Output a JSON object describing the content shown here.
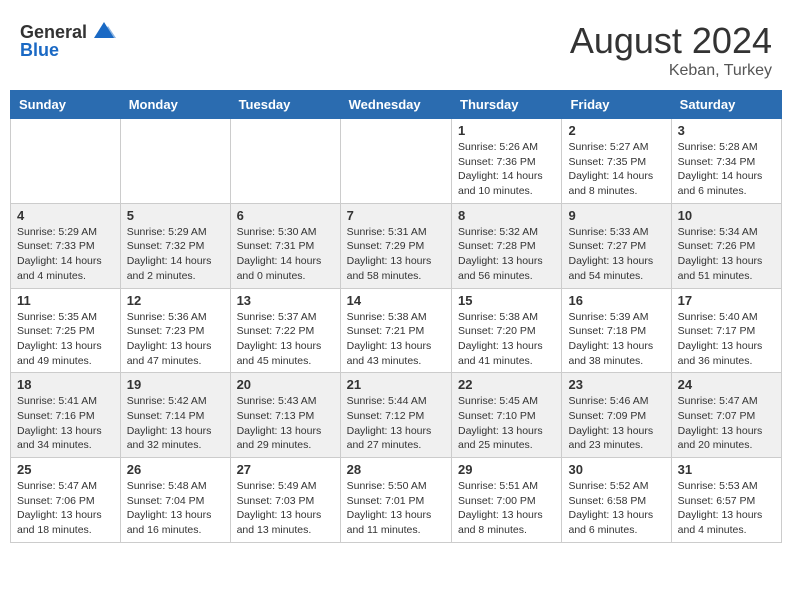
{
  "header": {
    "logo_general": "General",
    "logo_blue": "Blue",
    "month_year": "August 2024",
    "location": "Keban, Turkey"
  },
  "days_of_week": [
    "Sunday",
    "Monday",
    "Tuesday",
    "Wednesday",
    "Thursday",
    "Friday",
    "Saturday"
  ],
  "weeks": [
    [
      {
        "day": "",
        "sunrise": "",
        "sunset": "",
        "daylight": ""
      },
      {
        "day": "",
        "sunrise": "",
        "sunset": "",
        "daylight": ""
      },
      {
        "day": "",
        "sunrise": "",
        "sunset": "",
        "daylight": ""
      },
      {
        "day": "",
        "sunrise": "",
        "sunset": "",
        "daylight": ""
      },
      {
        "day": "1",
        "sunrise": "Sunrise: 5:26 AM",
        "sunset": "Sunset: 7:36 PM",
        "daylight": "Daylight: 14 hours and 10 minutes."
      },
      {
        "day": "2",
        "sunrise": "Sunrise: 5:27 AM",
        "sunset": "Sunset: 7:35 PM",
        "daylight": "Daylight: 14 hours and 8 minutes."
      },
      {
        "day": "3",
        "sunrise": "Sunrise: 5:28 AM",
        "sunset": "Sunset: 7:34 PM",
        "daylight": "Daylight: 14 hours and 6 minutes."
      }
    ],
    [
      {
        "day": "4",
        "sunrise": "Sunrise: 5:29 AM",
        "sunset": "Sunset: 7:33 PM",
        "daylight": "Daylight: 14 hours and 4 minutes."
      },
      {
        "day": "5",
        "sunrise": "Sunrise: 5:29 AM",
        "sunset": "Sunset: 7:32 PM",
        "daylight": "Daylight: 14 hours and 2 minutes."
      },
      {
        "day": "6",
        "sunrise": "Sunrise: 5:30 AM",
        "sunset": "Sunset: 7:31 PM",
        "daylight": "Daylight: 14 hours and 0 minutes."
      },
      {
        "day": "7",
        "sunrise": "Sunrise: 5:31 AM",
        "sunset": "Sunset: 7:29 PM",
        "daylight": "Daylight: 13 hours and 58 minutes."
      },
      {
        "day": "8",
        "sunrise": "Sunrise: 5:32 AM",
        "sunset": "Sunset: 7:28 PM",
        "daylight": "Daylight: 13 hours and 56 minutes."
      },
      {
        "day": "9",
        "sunrise": "Sunrise: 5:33 AM",
        "sunset": "Sunset: 7:27 PM",
        "daylight": "Daylight: 13 hours and 54 minutes."
      },
      {
        "day": "10",
        "sunrise": "Sunrise: 5:34 AM",
        "sunset": "Sunset: 7:26 PM",
        "daylight": "Daylight: 13 hours and 51 minutes."
      }
    ],
    [
      {
        "day": "11",
        "sunrise": "Sunrise: 5:35 AM",
        "sunset": "Sunset: 7:25 PM",
        "daylight": "Daylight: 13 hours and 49 minutes."
      },
      {
        "day": "12",
        "sunrise": "Sunrise: 5:36 AM",
        "sunset": "Sunset: 7:23 PM",
        "daylight": "Daylight: 13 hours and 47 minutes."
      },
      {
        "day": "13",
        "sunrise": "Sunrise: 5:37 AM",
        "sunset": "Sunset: 7:22 PM",
        "daylight": "Daylight: 13 hours and 45 minutes."
      },
      {
        "day": "14",
        "sunrise": "Sunrise: 5:38 AM",
        "sunset": "Sunset: 7:21 PM",
        "daylight": "Daylight: 13 hours and 43 minutes."
      },
      {
        "day": "15",
        "sunrise": "Sunrise: 5:38 AM",
        "sunset": "Sunset: 7:20 PM",
        "daylight": "Daylight: 13 hours and 41 minutes."
      },
      {
        "day": "16",
        "sunrise": "Sunrise: 5:39 AM",
        "sunset": "Sunset: 7:18 PM",
        "daylight": "Daylight: 13 hours and 38 minutes."
      },
      {
        "day": "17",
        "sunrise": "Sunrise: 5:40 AM",
        "sunset": "Sunset: 7:17 PM",
        "daylight": "Daylight: 13 hours and 36 minutes."
      }
    ],
    [
      {
        "day": "18",
        "sunrise": "Sunrise: 5:41 AM",
        "sunset": "Sunset: 7:16 PM",
        "daylight": "Daylight: 13 hours and 34 minutes."
      },
      {
        "day": "19",
        "sunrise": "Sunrise: 5:42 AM",
        "sunset": "Sunset: 7:14 PM",
        "daylight": "Daylight: 13 hours and 32 minutes."
      },
      {
        "day": "20",
        "sunrise": "Sunrise: 5:43 AM",
        "sunset": "Sunset: 7:13 PM",
        "daylight": "Daylight: 13 hours and 29 minutes."
      },
      {
        "day": "21",
        "sunrise": "Sunrise: 5:44 AM",
        "sunset": "Sunset: 7:12 PM",
        "daylight": "Daylight: 13 hours and 27 minutes."
      },
      {
        "day": "22",
        "sunrise": "Sunrise: 5:45 AM",
        "sunset": "Sunset: 7:10 PM",
        "daylight": "Daylight: 13 hours and 25 minutes."
      },
      {
        "day": "23",
        "sunrise": "Sunrise: 5:46 AM",
        "sunset": "Sunset: 7:09 PM",
        "daylight": "Daylight: 13 hours and 23 minutes."
      },
      {
        "day": "24",
        "sunrise": "Sunrise: 5:47 AM",
        "sunset": "Sunset: 7:07 PM",
        "daylight": "Daylight: 13 hours and 20 minutes."
      }
    ],
    [
      {
        "day": "25",
        "sunrise": "Sunrise: 5:47 AM",
        "sunset": "Sunset: 7:06 PM",
        "daylight": "Daylight: 13 hours and 18 minutes."
      },
      {
        "day": "26",
        "sunrise": "Sunrise: 5:48 AM",
        "sunset": "Sunset: 7:04 PM",
        "daylight": "Daylight: 13 hours and 16 minutes."
      },
      {
        "day": "27",
        "sunrise": "Sunrise: 5:49 AM",
        "sunset": "Sunset: 7:03 PM",
        "daylight": "Daylight: 13 hours and 13 minutes."
      },
      {
        "day": "28",
        "sunrise": "Sunrise: 5:50 AM",
        "sunset": "Sunset: 7:01 PM",
        "daylight": "Daylight: 13 hours and 11 minutes."
      },
      {
        "day": "29",
        "sunrise": "Sunrise: 5:51 AM",
        "sunset": "Sunset: 7:00 PM",
        "daylight": "Daylight: 13 hours and 8 minutes."
      },
      {
        "day": "30",
        "sunrise": "Sunrise: 5:52 AM",
        "sunset": "Sunset: 6:58 PM",
        "daylight": "Daylight: 13 hours and 6 minutes."
      },
      {
        "day": "31",
        "sunrise": "Sunrise: 5:53 AM",
        "sunset": "Sunset: 6:57 PM",
        "daylight": "Daylight: 13 hours and 4 minutes."
      }
    ]
  ]
}
